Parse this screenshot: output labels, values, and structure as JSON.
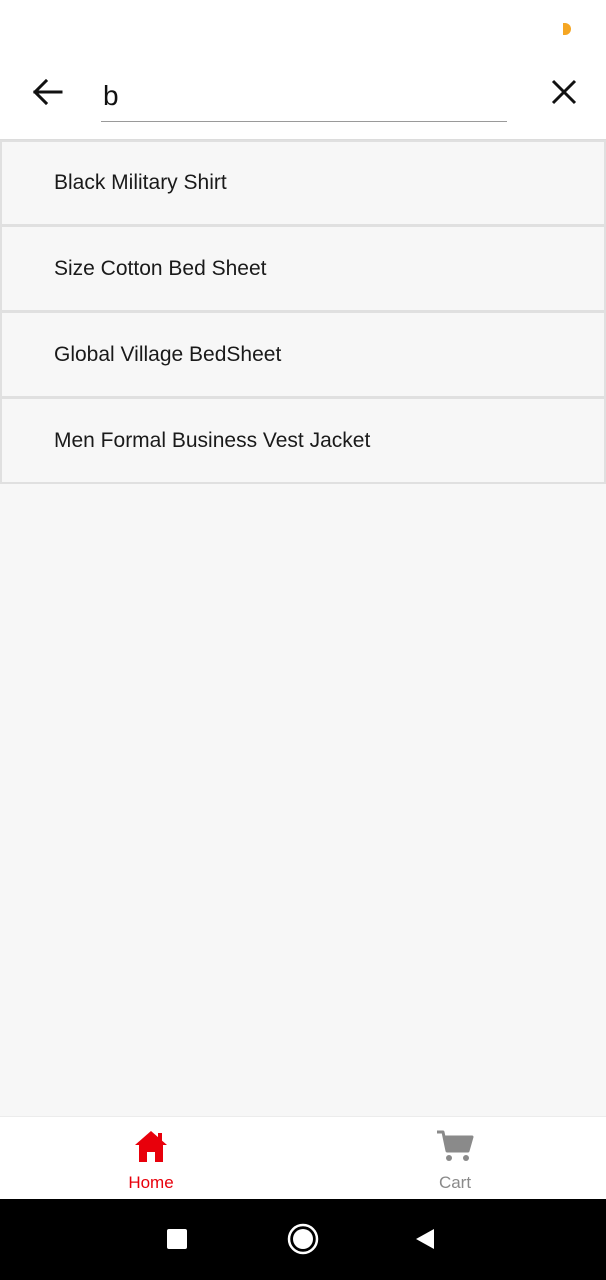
{
  "colors": {
    "accent": "#e8000b",
    "inactive": "#8a8a8a",
    "status_indicator": "#f5a623"
  },
  "search": {
    "query": "b",
    "back_icon": "arrow-left-icon",
    "clear_icon": "close-icon"
  },
  "suggestions": [
    {
      "label": "Black Military Shirt"
    },
    {
      "label": "Size Cotton Bed Sheet"
    },
    {
      "label": "Global Village BedSheet"
    },
    {
      "label": "Men Formal Business Vest Jacket"
    }
  ],
  "bottom_nav": {
    "items": [
      {
        "label": "Home",
        "icon": "home-icon",
        "active": true
      },
      {
        "label": "Cart",
        "icon": "cart-icon",
        "active": false
      }
    ]
  },
  "system_nav": {
    "recents_icon": "square-icon",
    "home_icon": "circle-icon",
    "back_icon": "triangle-back-icon"
  }
}
